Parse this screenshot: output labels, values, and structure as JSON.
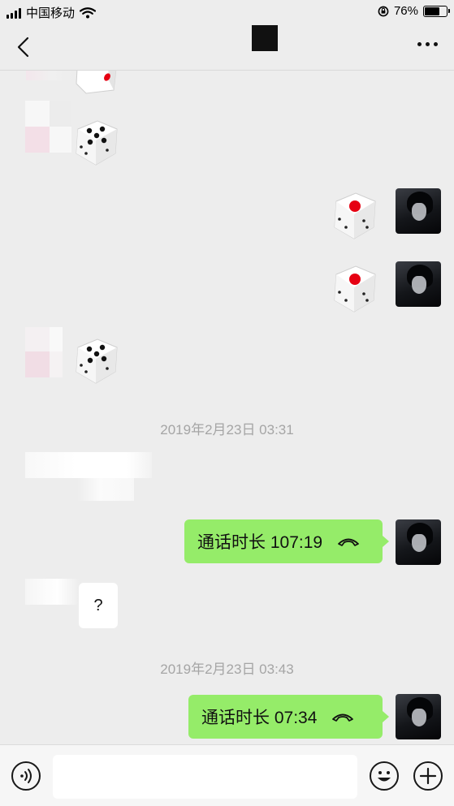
{
  "status_bar": {
    "carrier": "中国移动",
    "battery": "76%",
    "battery_level": 0.76,
    "icons": [
      "signal-icon",
      "wifi-icon",
      "orientation-lock-icon",
      "battery-icon"
    ]
  },
  "nav": {
    "back_icon": "chevron-left-icon",
    "more_icon": "more-dots-icon"
  },
  "messages": {
    "dice": [
      {
        "side": "left",
        "face": 1
      },
      {
        "side": "left",
        "face": 5
      },
      {
        "side": "right",
        "face": 1
      },
      {
        "side": "right",
        "face": 1
      },
      {
        "side": "left",
        "face": 5
      }
    ],
    "timestamp_1": "2019年2月23日 03:31",
    "call_1": "通话时长 107:19",
    "question": "?",
    "timestamp_2": "2019年2月23日 03:43",
    "call_2": "通话时长 07:34",
    "call_icon": "hang-up-phone-icon"
  },
  "input_bar": {
    "voice_icon": "voice-icon",
    "emoji_icon": "emoji-icon",
    "add_icon": "plus-icon",
    "message_value": ""
  },
  "colors": {
    "background": "#ededed",
    "bubble_green": "#95ec69",
    "dice_red": "#e60012",
    "timestamp": "#a5a5a5"
  }
}
